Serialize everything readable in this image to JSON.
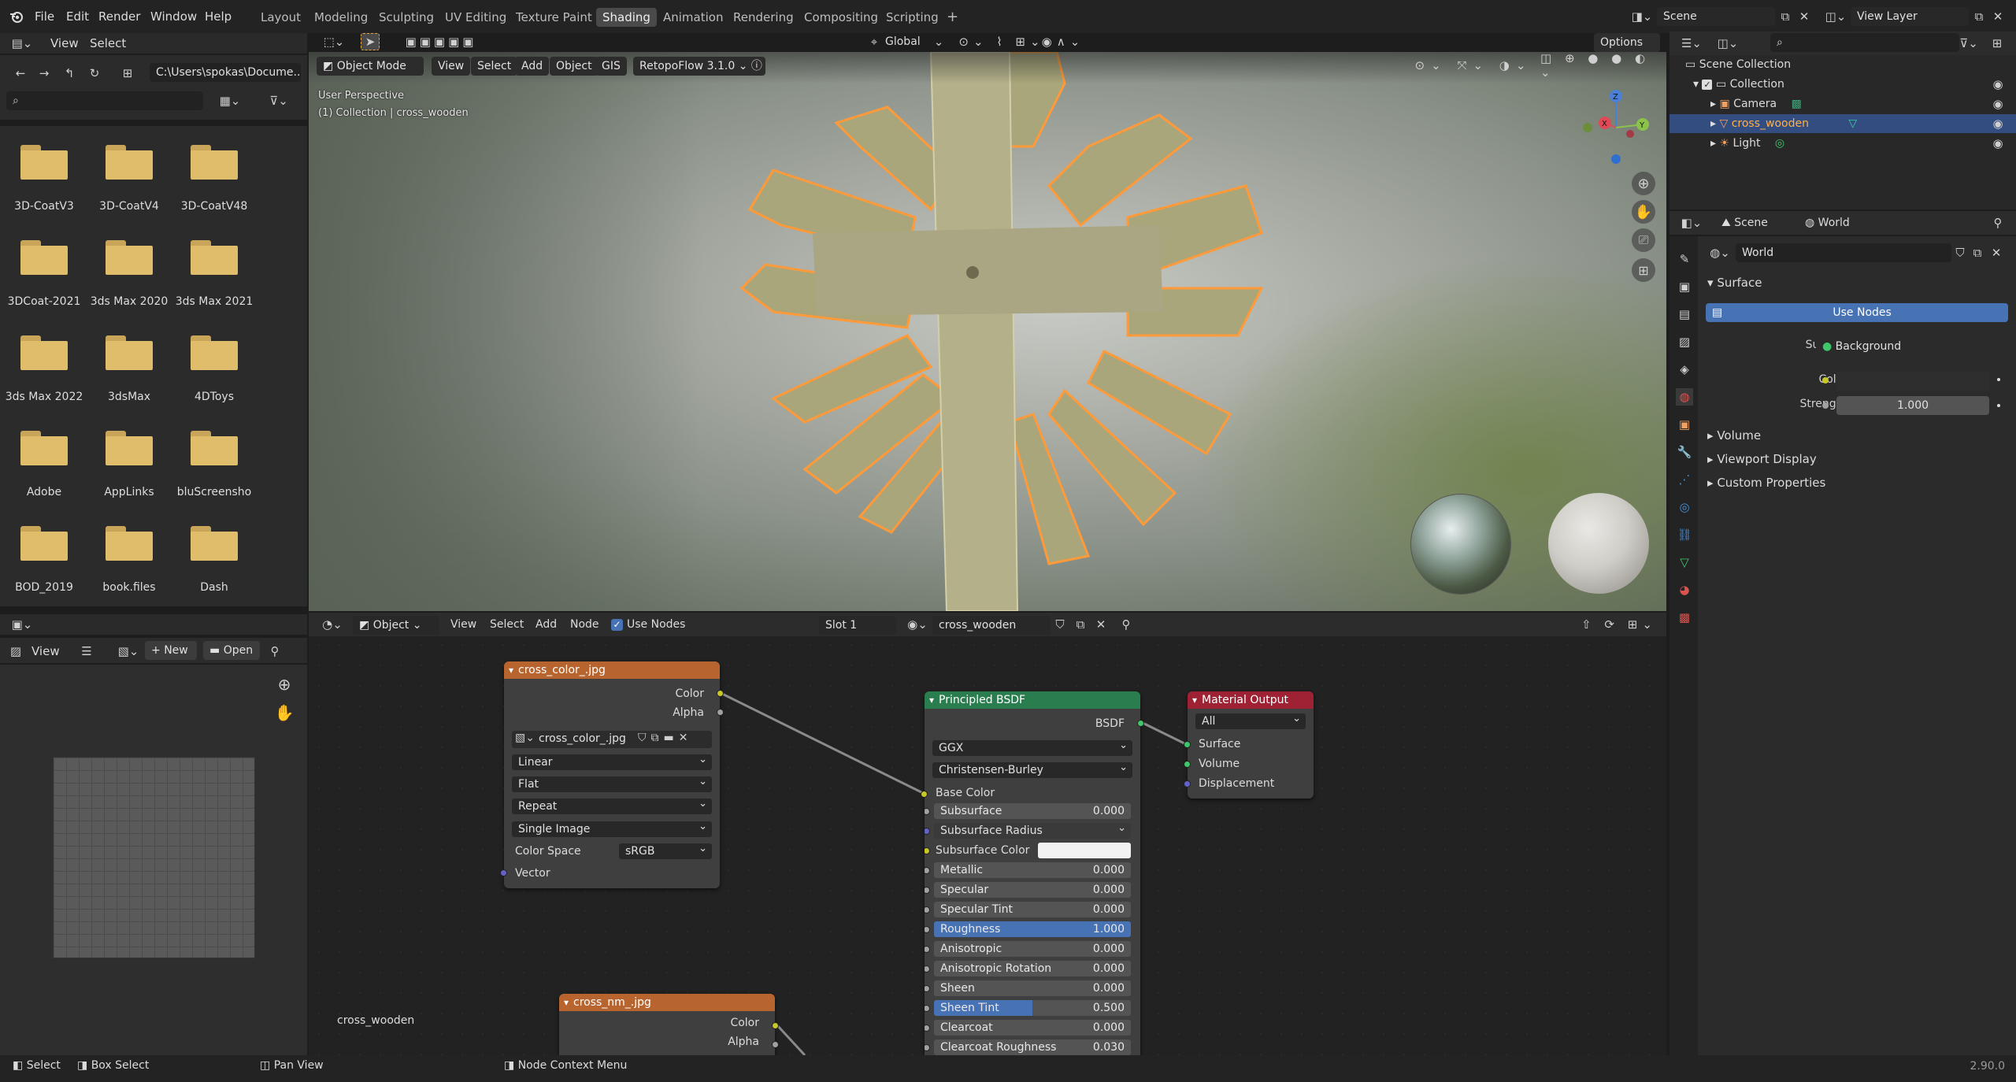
{
  "topbar": {
    "menus": [
      "File",
      "Edit",
      "Render",
      "Window",
      "Help"
    ],
    "workspaces": [
      "Layout",
      "Modeling",
      "Sculpting",
      "UV Editing",
      "Texture Paint",
      "Shading",
      "Animation",
      "Rendering",
      "Compositing",
      "Scripting"
    ],
    "active_workspace": "Shading",
    "add_workspace": "+",
    "scene": "Scene",
    "view_layer": "View Layer"
  },
  "file_browser": {
    "header_menus": [
      "View",
      "Select"
    ],
    "path": "C:\\Users\\spokas\\Docume...",
    "search_placeholder": "",
    "folders": [
      "3D-CoatV3",
      "3D-CoatV4",
      "3D-CoatV48",
      "3DCoat-2021",
      "3ds Max 2020",
      "3ds Max 2021",
      "3ds Max 2022",
      "3dsMax",
      "4DToys",
      "Adobe",
      "AppLinks",
      "bluScreensho",
      "BOD_2019",
      "book.files",
      "Dash"
    ]
  },
  "image_editor": {
    "view": "View",
    "new": "New",
    "open": "Open"
  },
  "viewport": {
    "mode": "Object Mode",
    "menus": [
      "View",
      "Select",
      "Add",
      "Object",
      "GIS"
    ],
    "addon": "RetopoFlow 3.1.0",
    "transform": "Global",
    "options": "Options",
    "overlay_line1": "User Perspective",
    "overlay_line2": "(1) Collection | cross_wooden",
    "gizmo": {
      "x": "X",
      "y": "Y",
      "z": "Z"
    }
  },
  "node_editor": {
    "type": "Object",
    "menus": [
      "View",
      "Select",
      "Add",
      "Node"
    ],
    "use_nodes": "Use Nodes",
    "slot": "Slot 1",
    "material": "cross_wooden",
    "tree_label": "cross_wooden",
    "image_node": {
      "title": "cross_color_.jpg",
      "out_color": "Color",
      "out_alpha": "Alpha",
      "image": "cross_color_.jpg",
      "interp": "Linear",
      "projection": "Flat",
      "extension": "Repeat",
      "source": "Single Image",
      "colorspace_label": "Color Space",
      "colorspace": "sRGB",
      "in_vector": "Vector"
    },
    "nm_node": {
      "title": "cross_nm_.jpg",
      "out_color": "Color",
      "out_alpha": "Alpha"
    },
    "bsdf": {
      "title": "Principled BSDF",
      "out": "BSDF",
      "distribution": "GGX",
      "subsurface_method": "Christensen-Burley",
      "base_color": "Base Color",
      "subsurface_radius": "Subsurface Radius",
      "subsurface_color": "Subsurface Color",
      "params": [
        {
          "label": "Subsurface",
          "value": "0.000"
        },
        {
          "label": "Metallic",
          "value": "0.000"
        },
        {
          "label": "Specular",
          "value": "0.000"
        },
        {
          "label": "Specular Tint",
          "value": "0.000"
        },
        {
          "label": "Roughness",
          "value": "1.000"
        },
        {
          "label": "Anisotropic",
          "value": "0.000"
        },
        {
          "label": "Anisotropic Rotation",
          "value": "0.000"
        },
        {
          "label": "Sheen",
          "value": "0.000"
        },
        {
          "label": "Sheen Tint",
          "value": "0.500"
        },
        {
          "label": "Clearcoat",
          "value": "0.000"
        },
        {
          "label": "Clearcoat Roughness",
          "value": "0.030"
        }
      ]
    },
    "output": {
      "title": "Material Output",
      "target": "All",
      "surface": "Surface",
      "volume": "Volume",
      "displacement": "Displacement"
    }
  },
  "outliner": {
    "root": "Scene Collection",
    "collection": "Collection",
    "items": [
      "Camera",
      "cross_wooden",
      "Light"
    ]
  },
  "properties": {
    "scene_tab": "Scene",
    "world_tab": "World",
    "world_name": "World",
    "surface_panel": "Surface",
    "use_nodes": "Use Nodes",
    "surface_label": "Surface",
    "surface_value": "Background",
    "color_label": "Color",
    "strength_label": "Strength",
    "strength_value": "1.000",
    "panels": [
      "Volume",
      "Viewport Display",
      "Custom Properties"
    ]
  },
  "statusbar": {
    "select": "Select",
    "box_select": "Box Select",
    "pan_view": "Pan View",
    "context_menu": "Node Context Menu",
    "version": "2.90.0"
  },
  "colors": {
    "image_header": "#b8642f",
    "bsdf_header": "#2a7d4f",
    "output_header": "#9e2233",
    "selected_blue": "#4772b3",
    "active_orange": "#ff9a3a"
  }
}
